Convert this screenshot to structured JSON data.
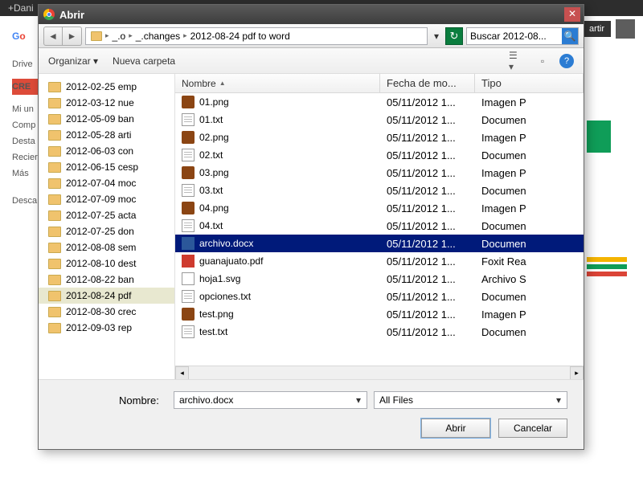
{
  "bg": {
    "topbar_user": "+Dani",
    "share": "artir"
  },
  "dialog": {
    "title": "Abrir",
    "breadcrumb": {
      "p1": "_.o",
      "p2": "_.changes",
      "p3": "2012-08-24 pdf to word"
    },
    "search_placeholder": "Buscar 2012-08...",
    "toolbar": {
      "organizar": "Organizar",
      "nueva": "Nueva carpeta"
    },
    "columns": {
      "name": "Nombre",
      "date": "Fecha de mo...",
      "type": "Tipo"
    },
    "folders": [
      "2012-02-25 emp",
      "2012-03-12 nue",
      "2012-05-09 ban",
      "2012-05-28 arti",
      "2012-06-03 con",
      "2012-06-15 cesp",
      "2012-07-04 moc",
      "2012-07-09 moc",
      "2012-07-25 acta",
      "2012-07-25 don",
      "2012-08-08 sem",
      "2012-08-10 dest",
      "2012-08-22 ban",
      "2012-08-24 pdf",
      "2012-08-30 crec",
      "2012-09-03 rep"
    ],
    "selected_folder_index": 13,
    "files": [
      {
        "name": "01.png",
        "date": "05/11/2012 1...",
        "type": "Imagen P",
        "icon": "png"
      },
      {
        "name": "01.txt",
        "date": "05/11/2012 1...",
        "type": "Documen",
        "icon": "txt"
      },
      {
        "name": "02.png",
        "date": "05/11/2012 1...",
        "type": "Imagen P",
        "icon": "png"
      },
      {
        "name": "02.txt",
        "date": "05/11/2012 1...",
        "type": "Documen",
        "icon": "txt"
      },
      {
        "name": "03.png",
        "date": "05/11/2012 1...",
        "type": "Imagen P",
        "icon": "png"
      },
      {
        "name": "03.txt",
        "date": "05/11/2012 1...",
        "type": "Documen",
        "icon": "txt"
      },
      {
        "name": "04.png",
        "date": "05/11/2012 1...",
        "type": "Imagen P",
        "icon": "png"
      },
      {
        "name": "04.txt",
        "date": "05/11/2012 1...",
        "type": "Documen",
        "icon": "txt"
      },
      {
        "name": "archivo.docx",
        "date": "05/11/2012 1...",
        "type": "Documen",
        "icon": "docx"
      },
      {
        "name": "guanajuato.pdf",
        "date": "05/11/2012 1...",
        "type": "Foxit Rea",
        "icon": "pdf"
      },
      {
        "name": "hoja1.svg",
        "date": "05/11/2012 1...",
        "type": "Archivo S",
        "icon": "svg"
      },
      {
        "name": "opciones.txt",
        "date": "05/11/2012 1...",
        "type": "Documen",
        "icon": "txt"
      },
      {
        "name": "test.png",
        "date": "05/11/2012 1...",
        "type": "Imagen P",
        "icon": "png"
      },
      {
        "name": "test.txt",
        "date": "05/11/2012 1...",
        "type": "Documen",
        "icon": "txt"
      }
    ],
    "selected_file_index": 8,
    "filename_label": "Nombre:",
    "filename_value": "archivo.docx",
    "filter_value": "All Files",
    "open_btn": "Abrir",
    "cancel_btn": "Cancelar"
  },
  "sidebar": {
    "drive": "Drive",
    "create": "CRE",
    "miun": "Mi un",
    "items": [
      "Comp",
      "Desta",
      "Recier",
      "Más",
      "Desca"
    ]
  }
}
